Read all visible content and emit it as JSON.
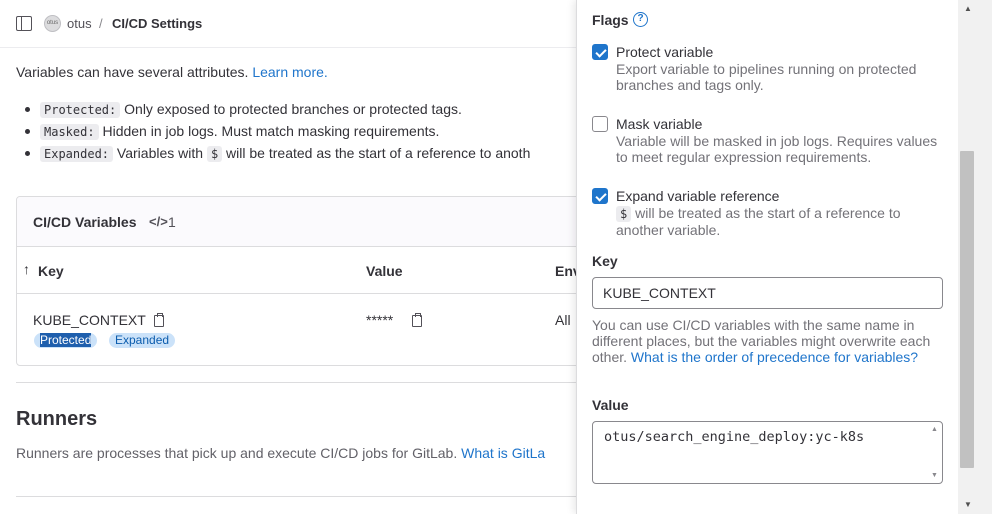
{
  "breadcrumb": {
    "group": "otus",
    "separator": "/",
    "current": "CI/CD Settings",
    "avatar_text": "otus"
  },
  "main": {
    "intro_text": "Variables can have several attributes. ",
    "intro_link": "Learn more.",
    "attributes": [
      {
        "code": "Protected:",
        "text": " Only exposed to protected branches or protected tags."
      },
      {
        "code": "Masked:",
        "text": " Hidden in job logs. Must match masking requirements."
      },
      {
        "code": "Expanded:",
        "text_before": " Variables with ",
        "code2": "$",
        "text_after": " will be treated as the start of a reference to anoth"
      }
    ]
  },
  "variables_card": {
    "title": "CI/CD Variables",
    "count_icon": "</>",
    "count": "1",
    "columns": {
      "sort_icon": "↑",
      "key": "Key",
      "value": "Value",
      "env": "Env"
    },
    "row": {
      "key": "KUBE_CONTEXT",
      "value": "*****",
      "env": "All",
      "badges": {
        "protected": "Protected",
        "expanded": "Expanded"
      }
    }
  },
  "runners": {
    "title": "Runners",
    "description": "Runners are processes that pick up and execute CI/CD jobs for GitLab. ",
    "link": "What is GitLa"
  },
  "drawer": {
    "flags_title": "Flags",
    "help_icon": "?",
    "flags": [
      {
        "label": "Protect variable",
        "checked": true,
        "help": "Export variable to pipelines running on protected branches and tags only."
      },
      {
        "label": "Mask variable",
        "checked": false,
        "help": "Variable will be masked in job logs. Requires values to meet regular expression requirements."
      },
      {
        "label": "Expand variable reference",
        "checked": true,
        "help_code": "$",
        "help": " will be treated as the start of a reference to another variable."
      }
    ],
    "key_label": "Key",
    "key_value": "KUBE_CONTEXT",
    "key_help": "You can use CI/CD variables with the same name in different places, but the variables might overwrite each other. ",
    "key_help_link": "What is the order of precedence for variables?",
    "value_label": "Value",
    "value_text": "otus/search_engine_deploy:yc-k8s"
  }
}
